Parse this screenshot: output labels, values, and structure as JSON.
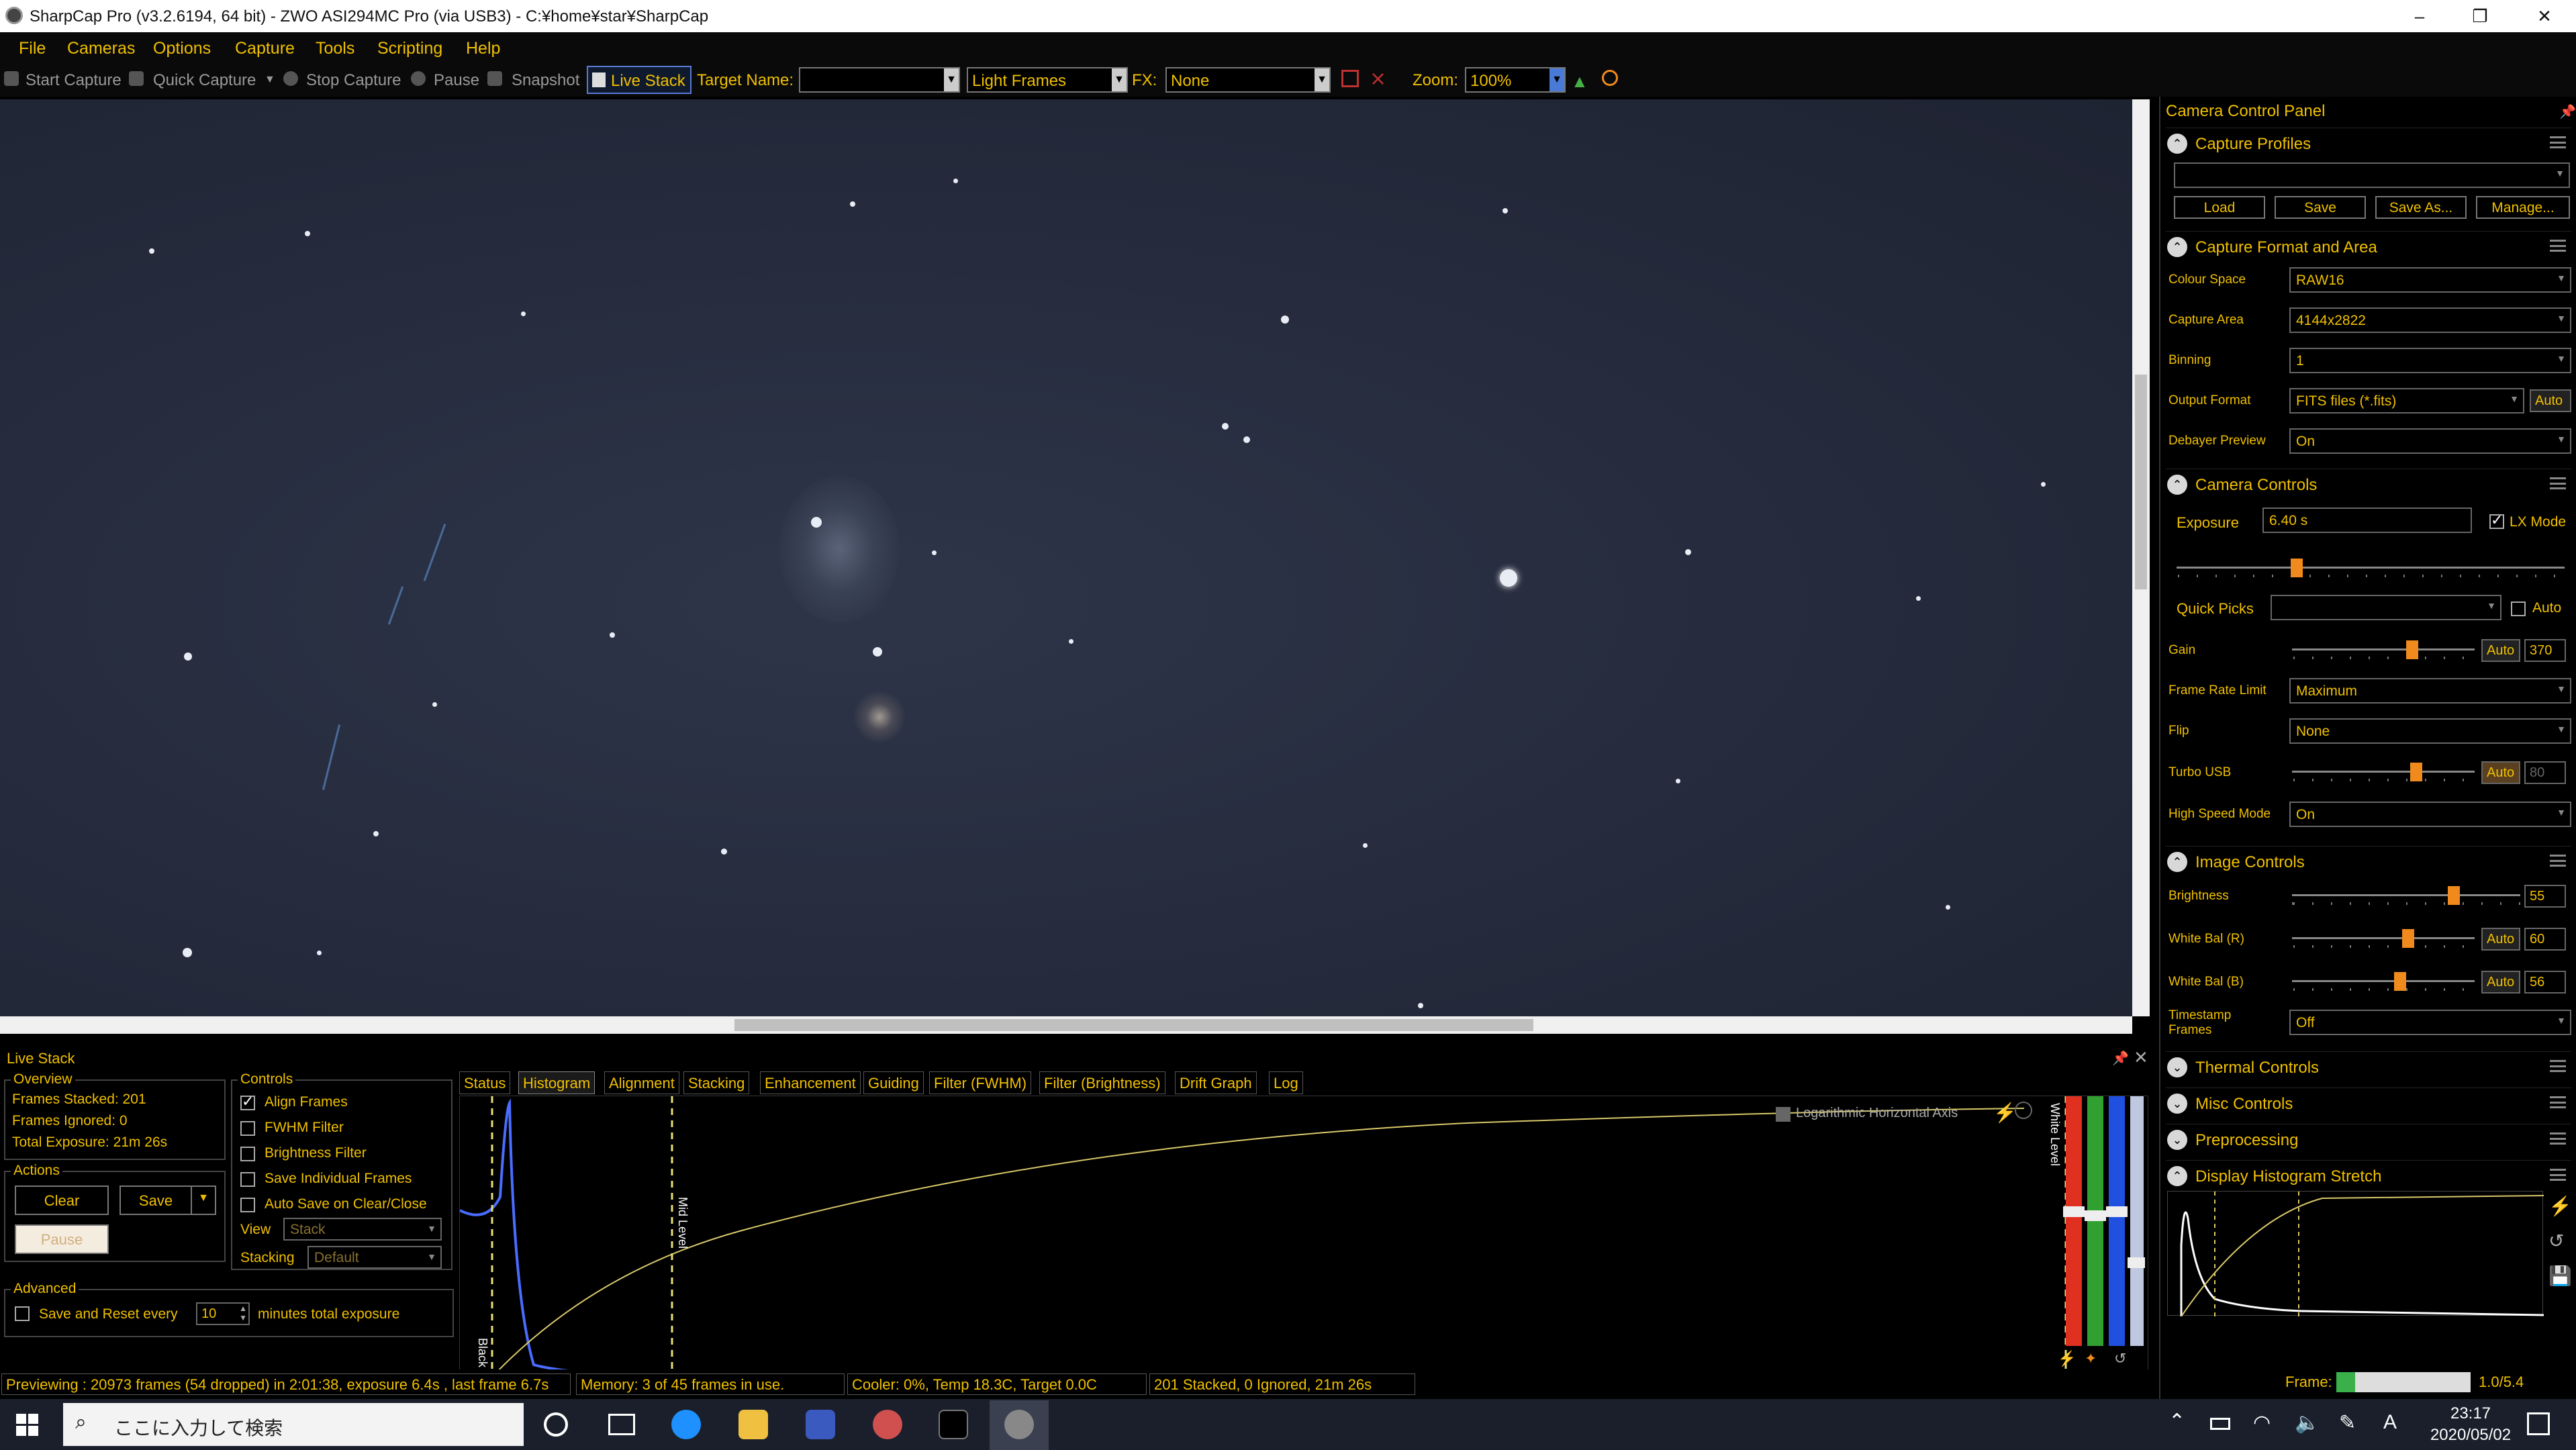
{
  "window": {
    "title": "SharpCap Pro (v3.2.6194, 64 bit) - ZWO ASI294MC Pro (via USB3) - C:¥home¥star¥SharpCap",
    "minimize": "–",
    "maximize": "❐",
    "close": "✕"
  },
  "menu": [
    "File",
    "Cameras",
    "Options",
    "Capture",
    "Tools",
    "Scripting",
    "Help"
  ],
  "toolbar": {
    "start_capture": "Start Capture",
    "quick_capture": "Quick Capture",
    "stop_capture": "Stop Capture",
    "pause": "Pause",
    "snapshot": "Snapshot",
    "live_stack": "Live Stack",
    "target_name_label": "Target Name:",
    "target_name_value": "",
    "frame_type": "Light Frames",
    "fx_label": "FX:",
    "fx_value": "None",
    "zoom_label": "Zoom:",
    "zoom_value": "100%"
  },
  "camera_panel": {
    "title": "Camera Control Panel",
    "capture_profiles": {
      "title": "Capture Profiles",
      "selected": "",
      "buttons": [
        "Load",
        "Save",
        "Save As...",
        "Manage..."
      ]
    },
    "capture_format": {
      "title": "Capture Format and Area",
      "colour_space_label": "Colour Space",
      "colour_space": "RAW16",
      "capture_area_label": "Capture Area",
      "capture_area": "4144x2822",
      "binning_label": "Binning",
      "binning": "1",
      "output_format_label": "Output Format",
      "output_format": "FITS files (*.fits)",
      "output_auto": "Auto",
      "debayer_label": "Debayer Preview",
      "debayer": "On"
    },
    "camera_controls": {
      "title": "Camera Controls",
      "exposure_label": "Exposure",
      "exposure": "6.40 s",
      "lx_mode": "LX Mode",
      "quick_picks_label": "Quick Picks",
      "quick_picks": "",
      "quick_auto": "Auto",
      "gain_label": "Gain",
      "gain_auto": "Auto",
      "gain": "370",
      "frame_rate_label": "Frame Rate Limit",
      "frame_rate": "Maximum",
      "flip_label": "Flip",
      "flip": "None",
      "turbo_label": "Turbo USB",
      "turbo_auto": "Auto",
      "turbo": "80",
      "hispeed_label": "High Speed Mode",
      "hispeed": "On"
    },
    "image_controls": {
      "title": "Image Controls",
      "brightness_label": "Brightness",
      "brightness": "55",
      "wb_r_label": "White Bal (R)",
      "wb_r_auto": "Auto",
      "wb_r": "60",
      "wb_b_label": "White Bal (B)",
      "wb_b_auto": "Auto",
      "wb_b": "56",
      "timestamp_label1": "Timestamp",
      "timestamp_label2": "Frames",
      "timestamp": "Off"
    },
    "collapsed_sections": [
      "Thermal Controls",
      "Misc Controls",
      "Preprocessing"
    ],
    "histogram_stretch": {
      "title": "Display Histogram Stretch"
    },
    "frame_label": "Frame:",
    "frame_value": "1.0/5.4",
    "frame_progress": 0.14
  },
  "live_stack": {
    "title": "Live Stack",
    "overview_label": "Overview",
    "frames_stacked": "Frames Stacked:  201",
    "frames_ignored": "Frames Ignored:  0",
    "total_exposure": "Total Exposure:   21m 26s",
    "actions_label": "Actions",
    "clear": "Clear",
    "save": "Save",
    "pause": "Pause",
    "advanced_label": "Advanced",
    "save_reset_label": "Save and Reset every",
    "save_reset_value": "10",
    "save_reset_suffix": "minutes total exposure",
    "controls_label": "Controls",
    "align_frames": "Align Frames",
    "fwhm_filter": "FWHM Filter",
    "brightness_filter": "Brightness Filter",
    "save_individual": "Save Individual Frames",
    "auto_save": "Auto Save on Clear/Close",
    "view_label": "View",
    "view_value": "Stack",
    "stacking_label": "Stacking",
    "stacking_value": "Default",
    "tabs": [
      "Status",
      "Histogram",
      "Alignment",
      "Stacking",
      "Enhancement",
      "Guiding",
      "Filter (FWHM)",
      "Filter (Brightness)",
      "Drift Graph",
      "Log"
    ],
    "active_tab": "Histogram",
    "log_axis_label": "Logarithmic Horizontal Axis",
    "black_level": "Black Level",
    "mid_level": "Mid Level",
    "white_level": "White Level"
  },
  "statusbar": {
    "previewing": "Previewing : 20973 frames (54 dropped) in 2:01:38, exposure 6.4s , last frame 6.7s",
    "memory": "Memory: 3 of 45 frames in use.",
    "cooler": "Cooler: 0%, Temp 18.3C, Target 0.0C",
    "stacked": "201 Stacked, 0 Ignored, 21m 26s"
  },
  "taskbar": {
    "search_placeholder": "ここに入力して検索",
    "time": "23:17",
    "date": "2020/05/02",
    "ime": "A"
  },
  "colors": {
    "accent": "#f0c000",
    "slider_thumb": "#f08a1c",
    "sky": "#262c3d",
    "curve": "#d8c86a",
    "histogram_blue": "#4a6cff"
  }
}
